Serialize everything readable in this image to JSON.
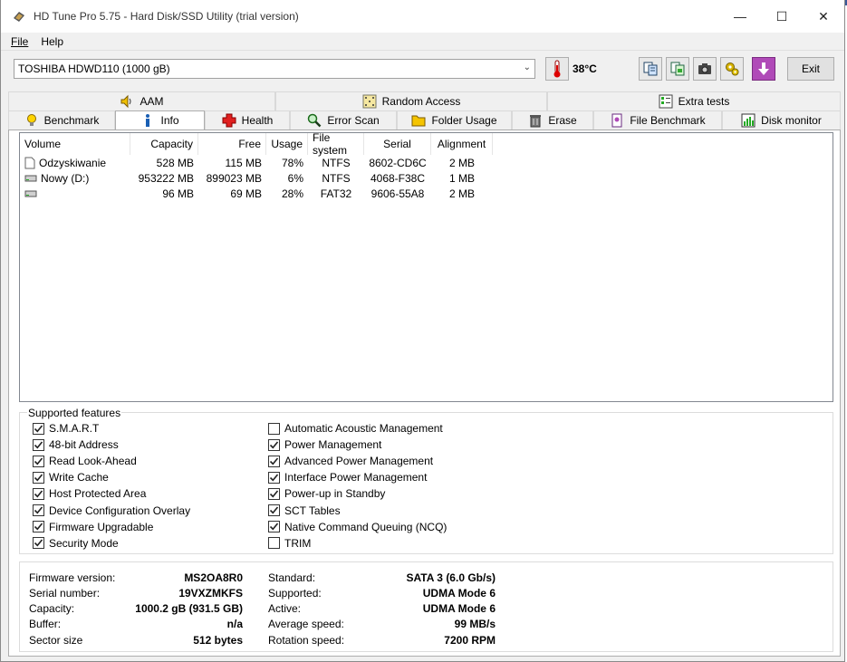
{
  "window": {
    "title": "HD Tune Pro 5.75 - Hard Disk/SSD Utility (trial version)",
    "controls": {
      "minimize": "—",
      "maximize": "☐",
      "close": "✕"
    }
  },
  "menu": {
    "file": "File",
    "help": "Help"
  },
  "toolbar": {
    "drive": "TOSHIBA HDWD110 (1000 gB)",
    "temperature": "38°C",
    "exit_label": "Exit"
  },
  "tabs_top": [
    {
      "label": "AAM",
      "icon": "speaker-icon"
    },
    {
      "label": "Random Access",
      "icon": "dice-icon"
    },
    {
      "label": "Extra tests",
      "icon": "checklist-icon"
    }
  ],
  "tabs_bottom": [
    {
      "label": "Benchmark",
      "icon": "lightbulb-icon"
    },
    {
      "label": "Info",
      "icon": "info-icon",
      "active": true
    },
    {
      "label": "Health",
      "icon": "health-cross-icon"
    },
    {
      "label": "Error Scan",
      "icon": "magnifier-icon"
    },
    {
      "label": "Folder Usage",
      "icon": "folder-icon"
    },
    {
      "label": "Erase",
      "icon": "trash-icon"
    },
    {
      "label": "File Benchmark",
      "icon": "file-benchmark-icon"
    },
    {
      "label": "Disk monitor",
      "icon": "chart-icon"
    }
  ],
  "volumes": {
    "headers": [
      "Volume",
      "Capacity",
      "Free",
      "Usage",
      "File system",
      "Serial",
      "Alignment"
    ],
    "rows": [
      {
        "icon": "document-icon",
        "volume": "Odzyskiwanie",
        "capacity": "528 MB",
        "free": "115 MB",
        "usage": "78%",
        "fs": "NTFS",
        "serial": "8602-CD6C",
        "alignment": "2 MB"
      },
      {
        "icon": "drive-icon",
        "volume": "Nowy (D:)",
        "capacity": "953222 MB",
        "free": "899023 MB",
        "usage": "6%",
        "fs": "NTFS",
        "serial": "4068-F38C",
        "alignment": "1 MB"
      },
      {
        "icon": "drive-icon",
        "volume": "",
        "capacity": "96 MB",
        "free": "69 MB",
        "usage": "28%",
        "fs": "FAT32",
        "serial": "9606-55A8",
        "alignment": "2 MB"
      }
    ]
  },
  "features": {
    "legend": "Supported features",
    "left": [
      {
        "label": "S.M.A.R.T",
        "checked": true
      },
      {
        "label": "48-bit Address",
        "checked": true
      },
      {
        "label": "Read Look-Ahead",
        "checked": true
      },
      {
        "label": "Write Cache",
        "checked": true
      },
      {
        "label": "Host Protected Area",
        "checked": true
      },
      {
        "label": "Device Configuration Overlay",
        "checked": true
      },
      {
        "label": "Firmware Upgradable",
        "checked": true
      },
      {
        "label": "Security Mode",
        "checked": true
      }
    ],
    "right": [
      {
        "label": "Automatic Acoustic Management",
        "checked": false
      },
      {
        "label": "Power Management",
        "checked": true
      },
      {
        "label": "Advanced Power Management",
        "checked": true
      },
      {
        "label": "Interface Power Management",
        "checked": true
      },
      {
        "label": "Power-up in Standby",
        "checked": true
      },
      {
        "label": "SCT Tables",
        "checked": true
      },
      {
        "label": "Native Command Queuing (NCQ)",
        "checked": true
      },
      {
        "label": "TRIM",
        "checked": false
      }
    ]
  },
  "details": {
    "left": [
      {
        "label": "Firmware version:",
        "value": "MS2OA8R0"
      },
      {
        "label": "Serial number:",
        "value": "19VXZMKFS"
      },
      {
        "label": "Capacity:",
        "value": "1000.2 gB (931.5 GB)"
      },
      {
        "label": "Buffer:",
        "value": "n/a"
      },
      {
        "label": "Sector size",
        "value": "512 bytes"
      }
    ],
    "right": [
      {
        "label": "Standard:",
        "value": "SATA 3 (6.0 Gb/s)"
      },
      {
        "label": "Supported:",
        "value": "UDMA Mode 6"
      },
      {
        "label": "Active:",
        "value": "UDMA Mode 6"
      },
      {
        "label": "Average speed:",
        "value": "99 MB/s"
      },
      {
        "label": "Rotation speed:",
        "value": "7200 RPM"
      }
    ]
  }
}
